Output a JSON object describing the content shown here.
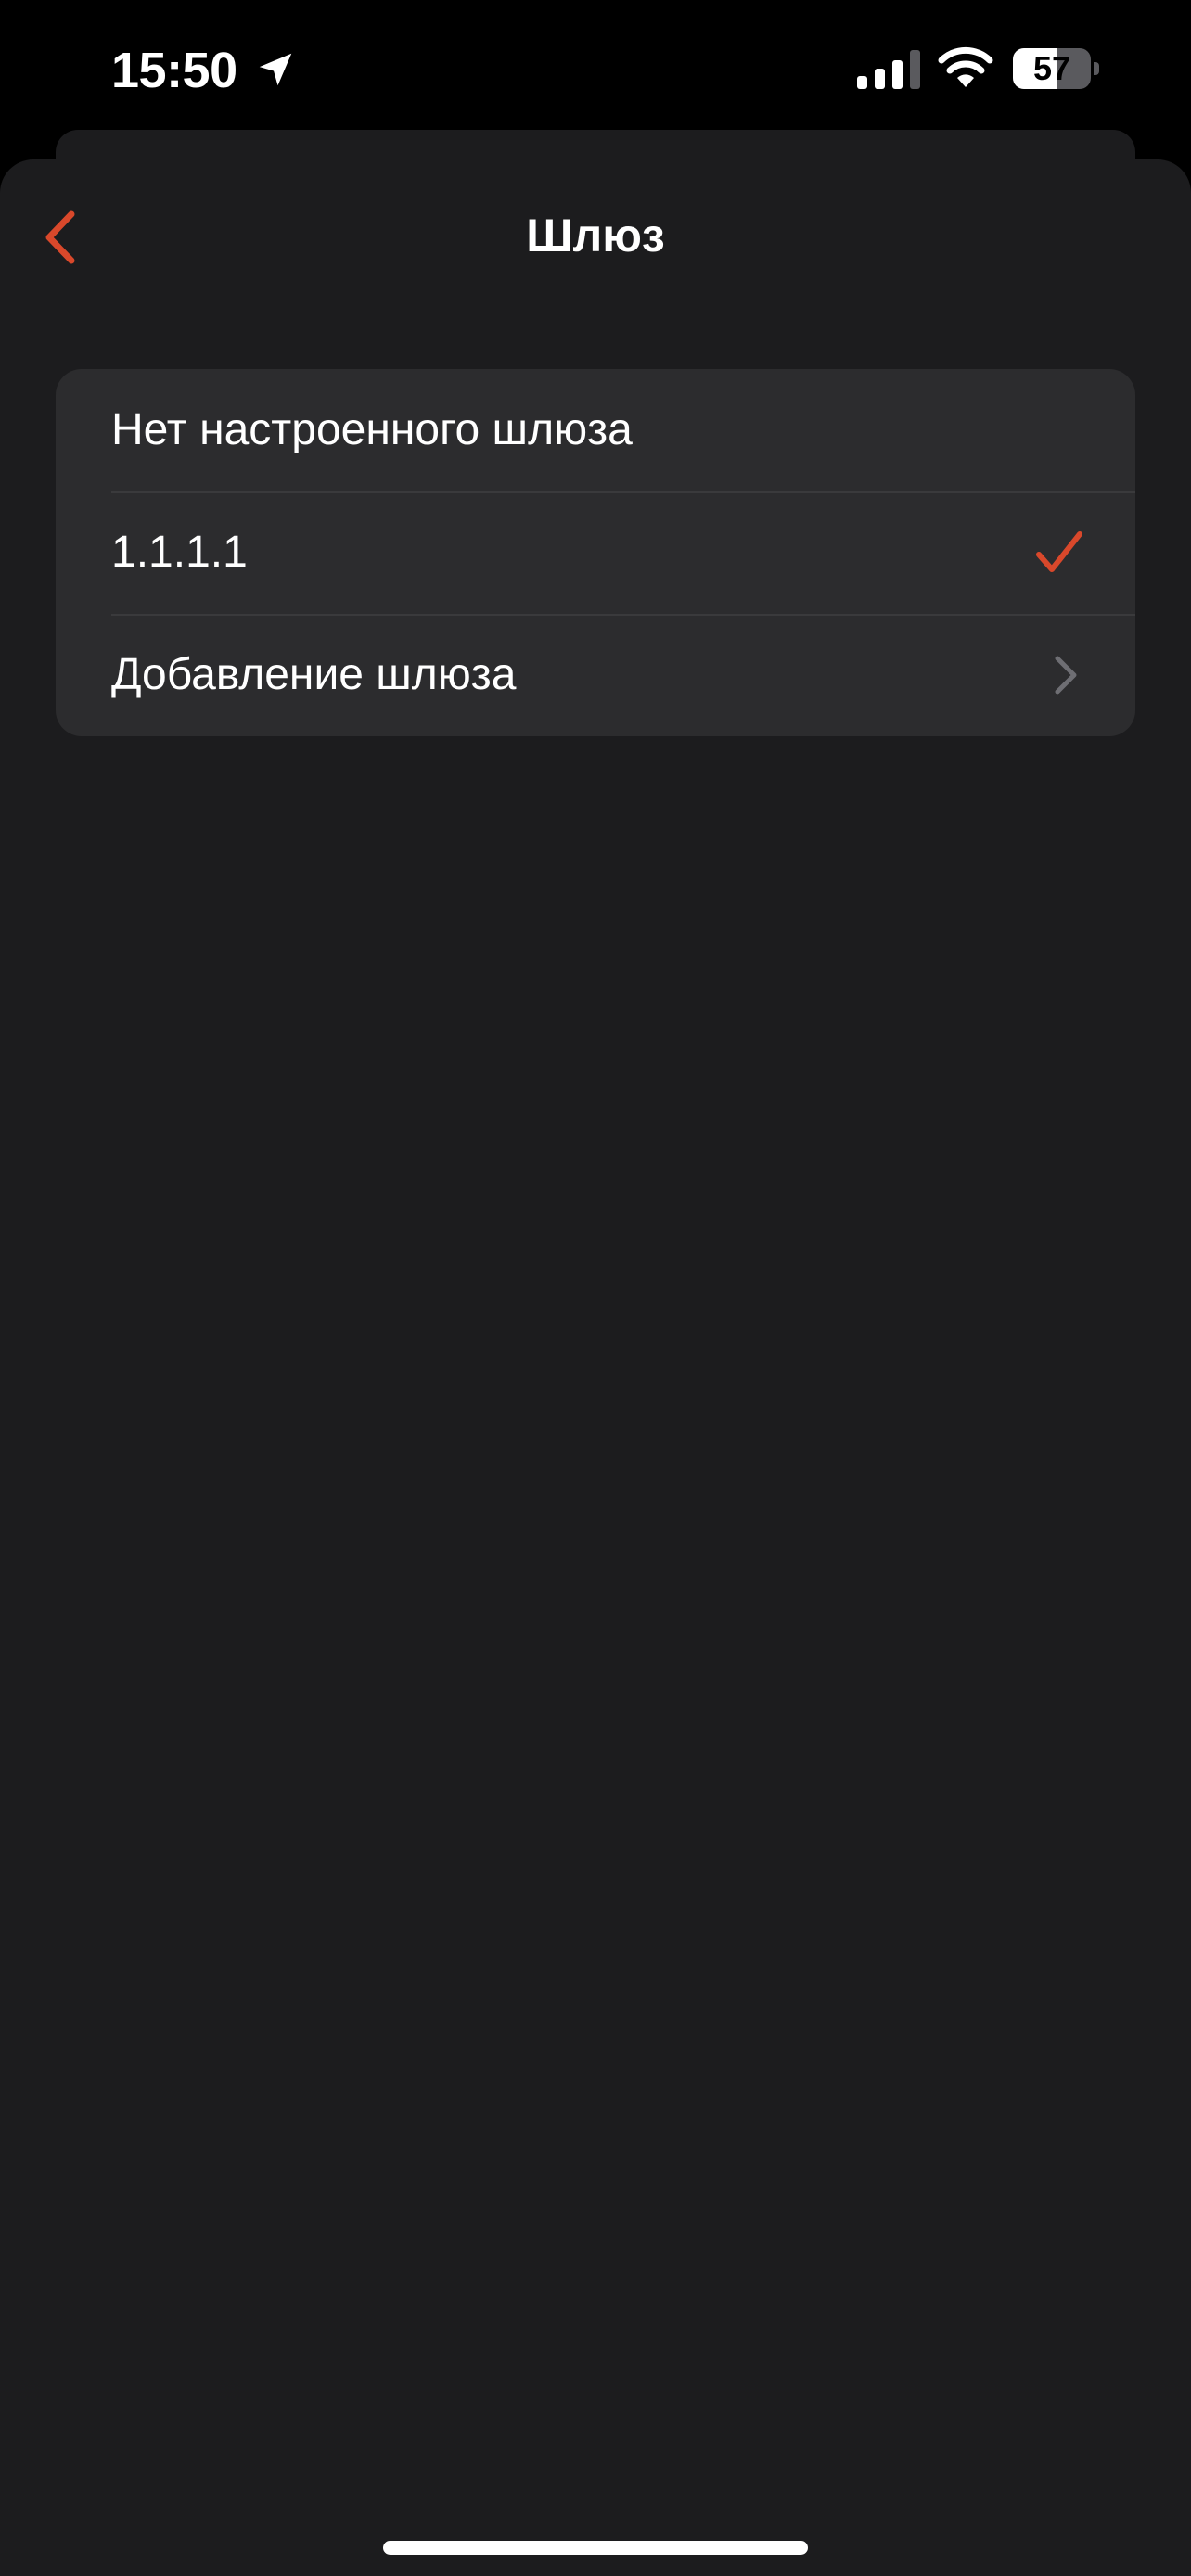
{
  "status_bar": {
    "time": "15:50",
    "battery_level": "57",
    "battery_fraction": 0.57,
    "icons": [
      "location-arrow-icon",
      "cellular-signal-icon",
      "wifi-icon",
      "battery-icon"
    ]
  },
  "nav": {
    "title": "Шлюз",
    "back_icon": "chevron-left-icon"
  },
  "gateway_list": {
    "items": [
      {
        "label": "Нет настроенного шлюза",
        "accessory": "none",
        "selected": false
      },
      {
        "label": "1.1.1.1",
        "accessory": "checkmark-icon",
        "selected": true
      },
      {
        "label": "Добавление шлюза",
        "accessory": "chevron-right-icon",
        "selected": false
      }
    ]
  },
  "colors": {
    "accent": "#d9482b",
    "sheet_background": "#1c1c1e",
    "group_background": "#2c2c2e",
    "separator": "#3a3a3c",
    "chevron": "#6e6e73"
  }
}
